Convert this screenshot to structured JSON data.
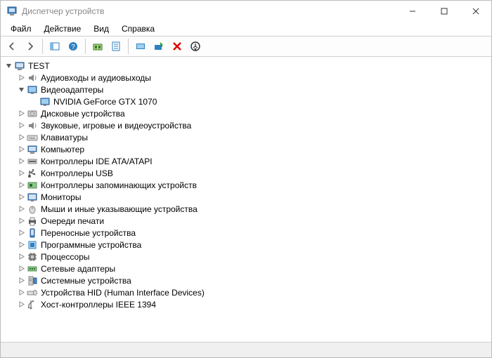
{
  "window": {
    "title": "Диспетчер устройств"
  },
  "menu": {
    "file": "Файл",
    "action": "Действие",
    "view": "Вид",
    "help": "Справка"
  },
  "tree": {
    "root": "TEST",
    "audio": "Аудиовходы и аудиовыходы",
    "display_adapters": "Видеоадаптеры",
    "gpu": "NVIDIA GeForce GTX 1070",
    "disk": "Дисковые устройства",
    "sound": "Звуковые, игровые и видеоустройства",
    "keyboards": "Клавиатуры",
    "computer": "Компьютер",
    "ide": "Контроллеры IDE ATA/ATAPI",
    "usb": "Контроллеры USB",
    "storage_ctrl": "Контроллеры запоминающих устройств",
    "monitors": "Мониторы",
    "mice": "Мыши и иные указывающие устройства",
    "print_queues": "Очереди печати",
    "portable": "Переносные устройства",
    "software_dev": "Программные устройства",
    "processors": "Процессоры",
    "network": "Сетевые адаптеры",
    "system": "Системные устройства",
    "hid": "Устройства HID (Human Interface Devices)",
    "ieee1394": "Хост-контроллеры IEEE 1394"
  }
}
